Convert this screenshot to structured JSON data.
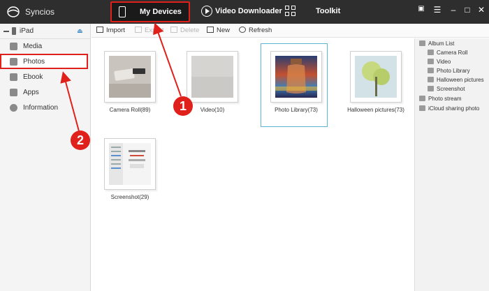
{
  "app": {
    "title": "Syncios"
  },
  "nav": {
    "my_devices": "My Devices",
    "video_downloader": "Video Downloader",
    "toolkit": "Toolkit"
  },
  "window_controls": [
    "chat-icon",
    "menu-icon",
    "minimize-icon",
    "maximize-icon",
    "close-icon"
  ],
  "device": {
    "name": "iPad"
  },
  "sidebar": {
    "items": [
      {
        "label": "Media",
        "icon": "media-icon"
      },
      {
        "label": "Photos",
        "icon": "photos-icon",
        "active": true
      },
      {
        "label": "Ebook",
        "icon": "ebook-icon"
      },
      {
        "label": "Apps",
        "icon": "apps-icon"
      },
      {
        "label": "Information",
        "icon": "info-icon"
      }
    ]
  },
  "toolbar": {
    "import": "Import",
    "export": "Export",
    "delete": "Delete",
    "new": "New",
    "refresh": "Refresh"
  },
  "albums": [
    {
      "caption": "Camera Roll(89)"
    },
    {
      "caption": "Video(10)"
    },
    {
      "caption": "Photo Library(73)",
      "selected": true
    },
    {
      "caption": "Halloween pictures(73)"
    },
    {
      "caption": "Screenshot(29)"
    }
  ],
  "right_panel": {
    "album_list": "Album List",
    "albums": [
      "Camera Roll",
      "Video",
      "Photo Library",
      "Halloween pictures",
      "Screenshot"
    ],
    "photo_stream": "Photo stream",
    "icloud": "iCloud sharing photo"
  },
  "annotations": [
    {
      "label": "1"
    },
    {
      "label": "2"
    }
  ],
  "colors": {
    "topbar": "#2e2e2e",
    "highlight_red": "#e0201a",
    "selection_blue": "#5ab4d6"
  }
}
